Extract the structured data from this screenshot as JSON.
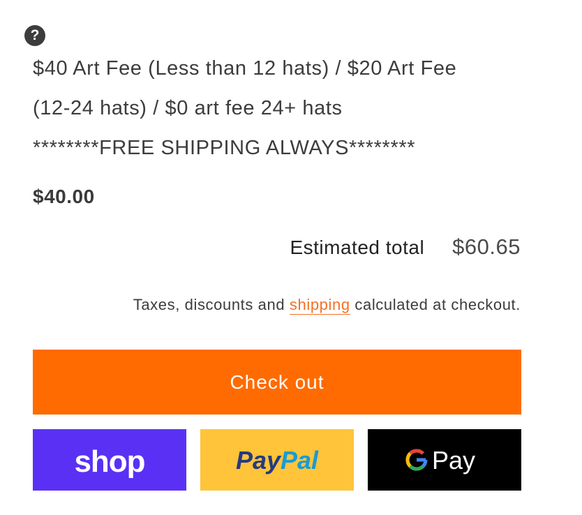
{
  "help": {
    "icon": "question-circle-icon",
    "glyph": "?"
  },
  "product": {
    "fee_lines": [
      "$40 Art Fee (Less than 12 hats) / $20 Art Fee",
      "(12-24 hats) / $0 art fee 24+ hats",
      "********FREE SHIPPING ALWAYS********"
    ],
    "price": "$40.00"
  },
  "summary": {
    "total_label": "Estimated total",
    "total_value": "$60.65",
    "tax_note_before": "Taxes, discounts and ",
    "tax_note_link": "shipping",
    "tax_note_after": " calculated at checkout."
  },
  "actions": {
    "checkout_label": "Check out",
    "checkout_color": "#ff6b00"
  },
  "express_pay": {
    "shop": {
      "label": "shop",
      "color": "#5a31f4",
      "icon": "shop-pay-logo"
    },
    "paypal": {
      "label_a": "Pay",
      "label_b": "Pal",
      "color": "#ffc439",
      "icon": "paypal-logo"
    },
    "gpay": {
      "label": "Pay",
      "color": "#000000",
      "icon": "google-g-icon"
    }
  }
}
